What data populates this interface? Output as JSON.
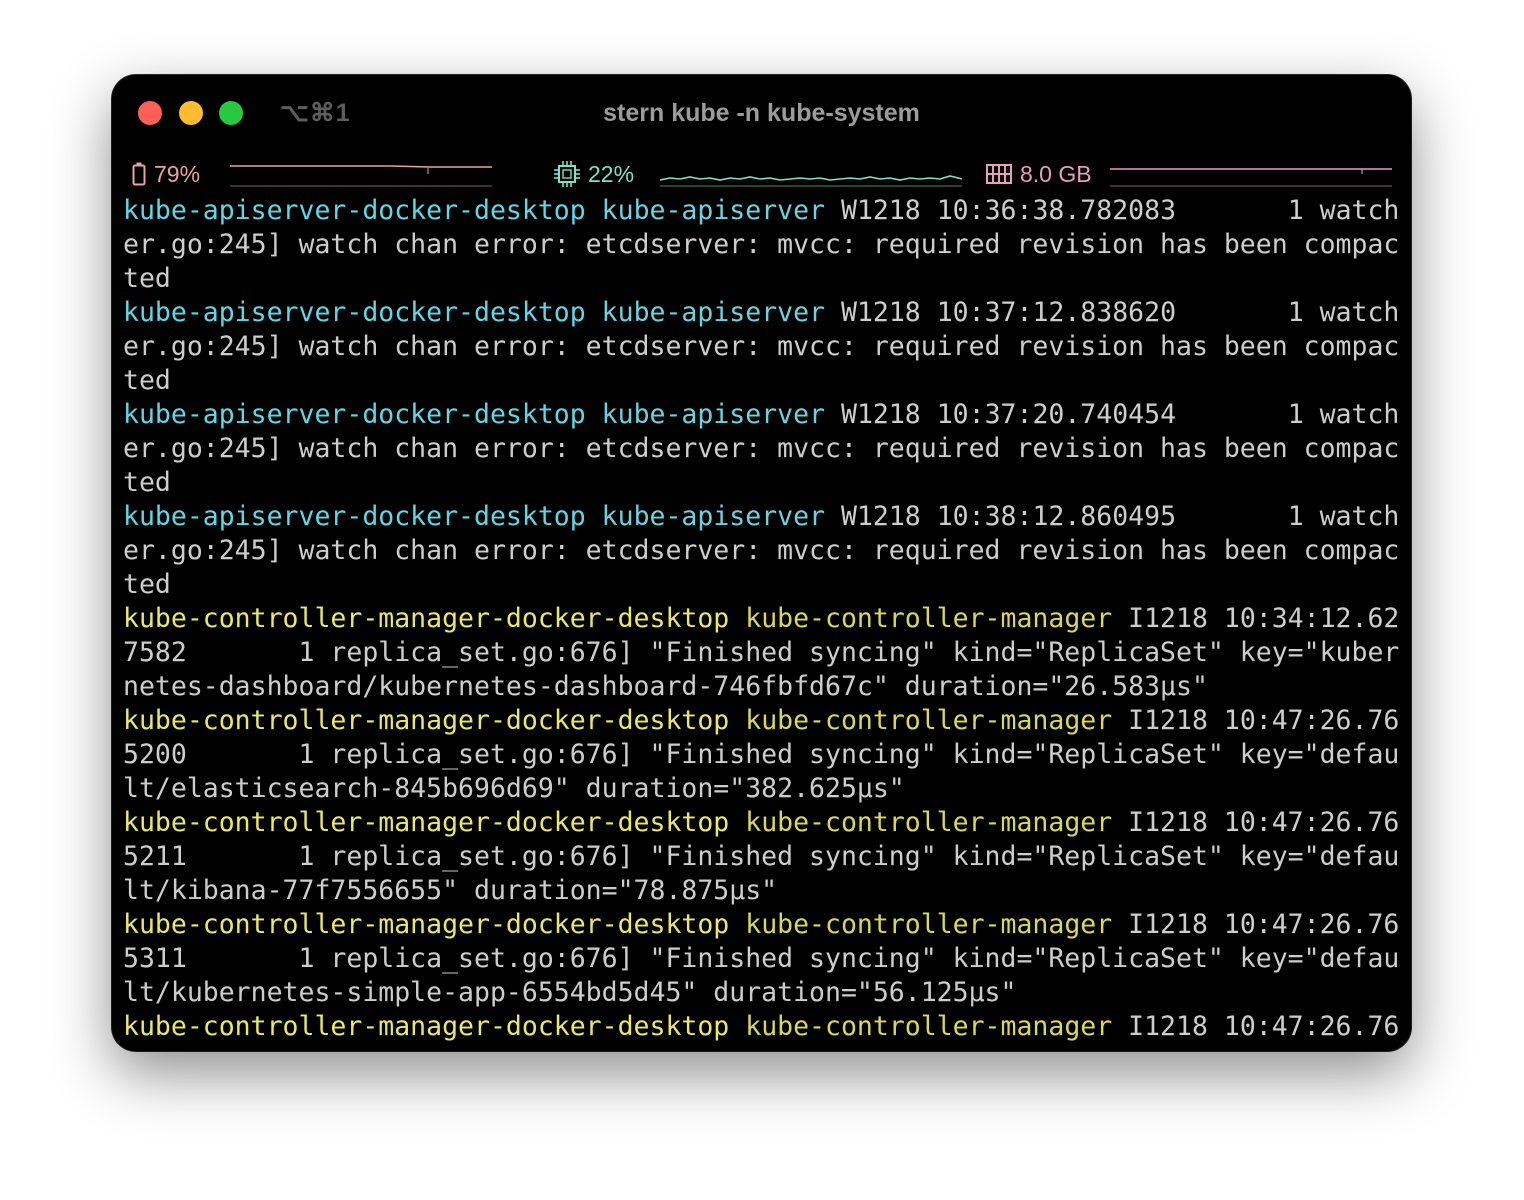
{
  "window": {
    "shortcut": "⌥⌘1",
    "title": "stern kube -n kube-system"
  },
  "status": {
    "battery": {
      "icon": "battery-icon",
      "value": "79%",
      "color": "#e8a3a3"
    },
    "cpu": {
      "icon": "cpu-icon",
      "value": "22%",
      "color": "#7de0c8"
    },
    "memory": {
      "icon": "memory-icon",
      "value": "8.0 GB",
      "color": "#e89fbf"
    }
  },
  "colors": {
    "pod_apiserver": "#5fd7e6",
    "container_apiserver": "#6fd1de",
    "pod_controller": "#e9e86a",
    "container_controller": "#d8d85a",
    "text": "#cdcdcd",
    "background": "#000000"
  },
  "log_entries": [
    {
      "pod": "kube-apiserver-docker-desktop",
      "container": "kube-apiserver",
      "first_rest": " W1218 10:36:38.782083       1 watch",
      "cont": [
        "er.go:245] watch chan error: etcdserver: mvcc: required revision has been compac",
        "ted"
      ]
    },
    {
      "pod": "kube-apiserver-docker-desktop",
      "container": "kube-apiserver",
      "first_rest": " W1218 10:37:12.838620       1 watch",
      "cont": [
        "er.go:245] watch chan error: etcdserver: mvcc: required revision has been compac",
        "ted"
      ]
    },
    {
      "pod": "kube-apiserver-docker-desktop",
      "container": "kube-apiserver",
      "first_rest": " W1218 10:37:20.740454       1 watch",
      "cont": [
        "er.go:245] watch chan error: etcdserver: mvcc: required revision has been compac",
        "ted"
      ]
    },
    {
      "pod": "kube-apiserver-docker-desktop",
      "container": "kube-apiserver",
      "first_rest": " W1218 10:38:12.860495       1 watch",
      "cont": [
        "er.go:245] watch chan error: etcdserver: mvcc: required revision has been compac",
        "ted"
      ]
    },
    {
      "pod": "kube-controller-manager-docker-desktop",
      "container": "kube-controller-manager",
      "first_rest": " I1218 10:34:12.62",
      "cont": [
        "7582       1 replica_set.go:676] \"Finished syncing\" kind=\"ReplicaSet\" key=\"kuber",
        "netes-dashboard/kubernetes-dashboard-746fbfd67c\" duration=\"26.583µs\""
      ]
    },
    {
      "pod": "kube-controller-manager-docker-desktop",
      "container": "kube-controller-manager",
      "first_rest": " I1218 10:47:26.76",
      "cont": [
        "5200       1 replica_set.go:676] \"Finished syncing\" kind=\"ReplicaSet\" key=\"defau",
        "lt/elasticsearch-845b696d69\" duration=\"382.625µs\""
      ]
    },
    {
      "pod": "kube-controller-manager-docker-desktop",
      "container": "kube-controller-manager",
      "first_rest": " I1218 10:47:26.76",
      "cont": [
        "5211       1 replica_set.go:676] \"Finished syncing\" kind=\"ReplicaSet\" key=\"defau",
        "lt/kibana-77f7556655\" duration=\"78.875µs\""
      ]
    },
    {
      "pod": "kube-controller-manager-docker-desktop",
      "container": "kube-controller-manager",
      "first_rest": " I1218 10:47:26.76",
      "cont": [
        "5311       1 replica_set.go:676] \"Finished syncing\" kind=\"ReplicaSet\" key=\"defau",
        "lt/kubernetes-simple-app-6554bd5d45\" duration=\"56.125µs\""
      ]
    },
    {
      "pod": "kube-controller-manager-docker-desktop",
      "container": "kube-controller-manager",
      "first_rest": " I1218 10:47:26.76",
      "cont": []
    }
  ]
}
